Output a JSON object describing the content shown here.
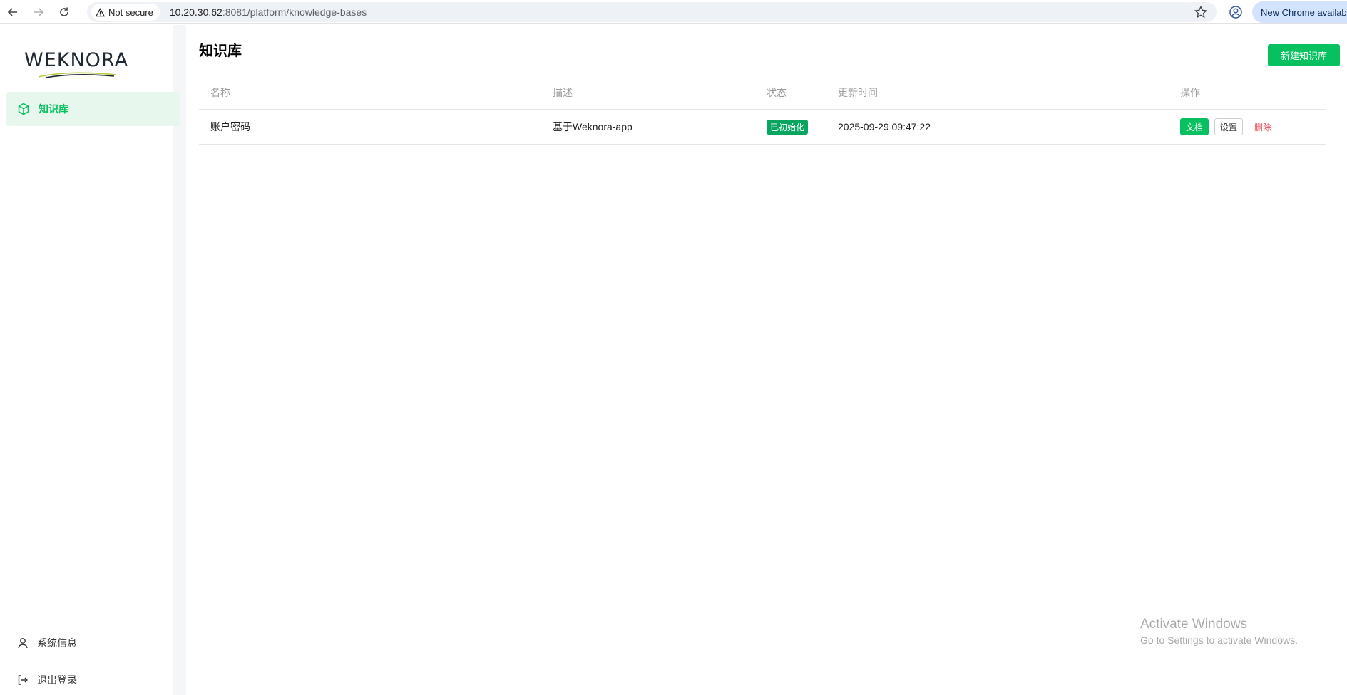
{
  "browser": {
    "security_label": "Not secure",
    "url_host": "10.20.30.62",
    "url_rest": ":8081/platform/knowledge-bases",
    "update_label": "New Chrome available"
  },
  "sidebar": {
    "logo_text": "WEKNORA",
    "nav_items": [
      {
        "label": "知识库",
        "icon": "cube-icon"
      }
    ],
    "bottom_items": [
      {
        "label": "系统信息",
        "icon": "user-icon"
      },
      {
        "label": "退出登录",
        "icon": "logout-icon"
      }
    ]
  },
  "main": {
    "title": "知识库",
    "create_button": "新建知识库",
    "table": {
      "headers": {
        "name": "名称",
        "description": "描述",
        "status": "状态",
        "updated": "更新时间",
        "actions": "操作"
      },
      "rows": [
        {
          "name": "账户密码",
          "description": "基于Weknora-app",
          "status": "已初始化",
          "updated": "2025-09-29 09:47:22",
          "actions": {
            "docs": "文档",
            "settings": "设置",
            "delete": "删除"
          }
        }
      ]
    }
  },
  "watermark": {
    "title": "Activate Windows",
    "subtitle": "Go to Settings to activate Windows."
  },
  "colors": {
    "accent": "#07c160",
    "danger": "#e34d59",
    "active_bg": "#e8f7ee"
  }
}
